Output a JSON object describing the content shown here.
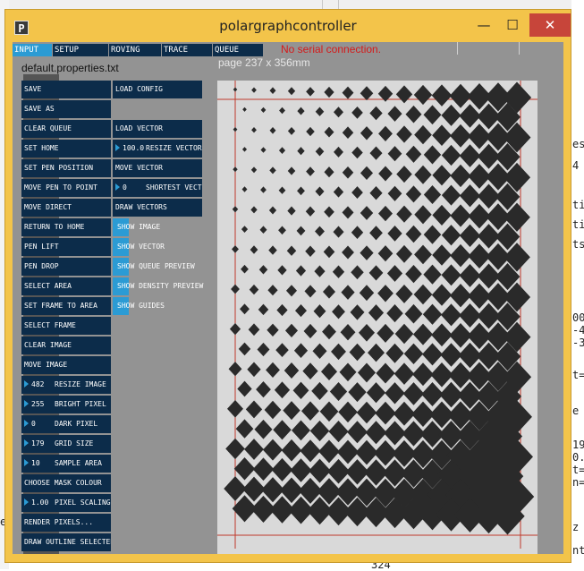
{
  "window": {
    "title": "polargraphcontroller",
    "minimize": "—",
    "maximize": "☐",
    "close": "✕",
    "icon_letter": "P"
  },
  "tabs": [
    "INPUT",
    "SETUP",
    "ROVING",
    "TRACE",
    "QUEUE"
  ],
  "status": {
    "serial": "No serial connection.",
    "properties_file": "default.properties.txt",
    "page_size": "page 237 x 356mm"
  },
  "left_buttons": [
    {
      "label": "SAVE"
    },
    {
      "label": "SAVE AS"
    },
    {
      "label": "CLEAR QUEUE"
    },
    {
      "label": "SET HOME"
    },
    {
      "label": "SET PEN POSITION"
    },
    {
      "label": "MOVE PEN TO POINT"
    },
    {
      "label": "MOVE DIRECT"
    },
    {
      "label": "RETURN TO HOME"
    },
    {
      "label": "PEN LIFT"
    },
    {
      "label": "PEN DROP"
    },
    {
      "label": "SELECT AREA"
    },
    {
      "label": "SET FRAME TO AREA"
    },
    {
      "label": "SELECT FRAME"
    },
    {
      "label": "CLEAR IMAGE"
    },
    {
      "label": "MOVE IMAGE"
    },
    {
      "label": "RESIZE IMAGE",
      "value": "482"
    },
    {
      "label": "BRIGHT PIXEL",
      "value": "255"
    },
    {
      "label": "DARK PIXEL",
      "value": "0"
    },
    {
      "label": "GRID SIZE",
      "value": "179"
    },
    {
      "label": "SAMPLE AREA",
      "value": "10"
    },
    {
      "label": "CHOOSE MASK COLOUR"
    },
    {
      "label": "PIXEL SCALING",
      "value": "1.00"
    },
    {
      "label": "RENDER PIXELS..."
    },
    {
      "label": "DRAW OUTLINE SELECTED"
    }
  ],
  "right_buttons": [
    {
      "label": "LOAD CONFIG"
    },
    {
      "label": "LOAD VECTOR"
    },
    {
      "label": "RESIZE VECTOR",
      "value": "100.0"
    },
    {
      "label": "MOVE VECTOR"
    },
    {
      "label": "SHORTEST VECTOR",
      "value": "0"
    },
    {
      "label": "DRAW VECTORS"
    }
  ],
  "toggles": [
    {
      "label": "SHOW IMAGE"
    },
    {
      "label": "SHOW VECTOR"
    },
    {
      "label": "SHOW QUEUE PREVIEW"
    },
    {
      "label": "SHOW DENSITY PREVIEW"
    },
    {
      "label": "SHOW GUIDES"
    }
  ],
  "background_editor_fragments": [
    "ti",
    "ti",
    "ts",
    "00",
    "-4",
    "-3",
    "t=",
    "e",
    "19",
    "0.",
    "t=",
    "n=",
    "er",
    "z",
    "nt",
    "324",
    "es",
    "4"
  ],
  "colors": {
    "window_frame": "#f3c44a",
    "client_bg": "#939393",
    "control_bg": "#0c2c4a",
    "accent": "#2b9bd4",
    "serial_error": "#d41a1a",
    "page_bg": "#d9d9d9",
    "guide_lines": "#c0392b",
    "pixel_fill": "#2a2a2a"
  }
}
